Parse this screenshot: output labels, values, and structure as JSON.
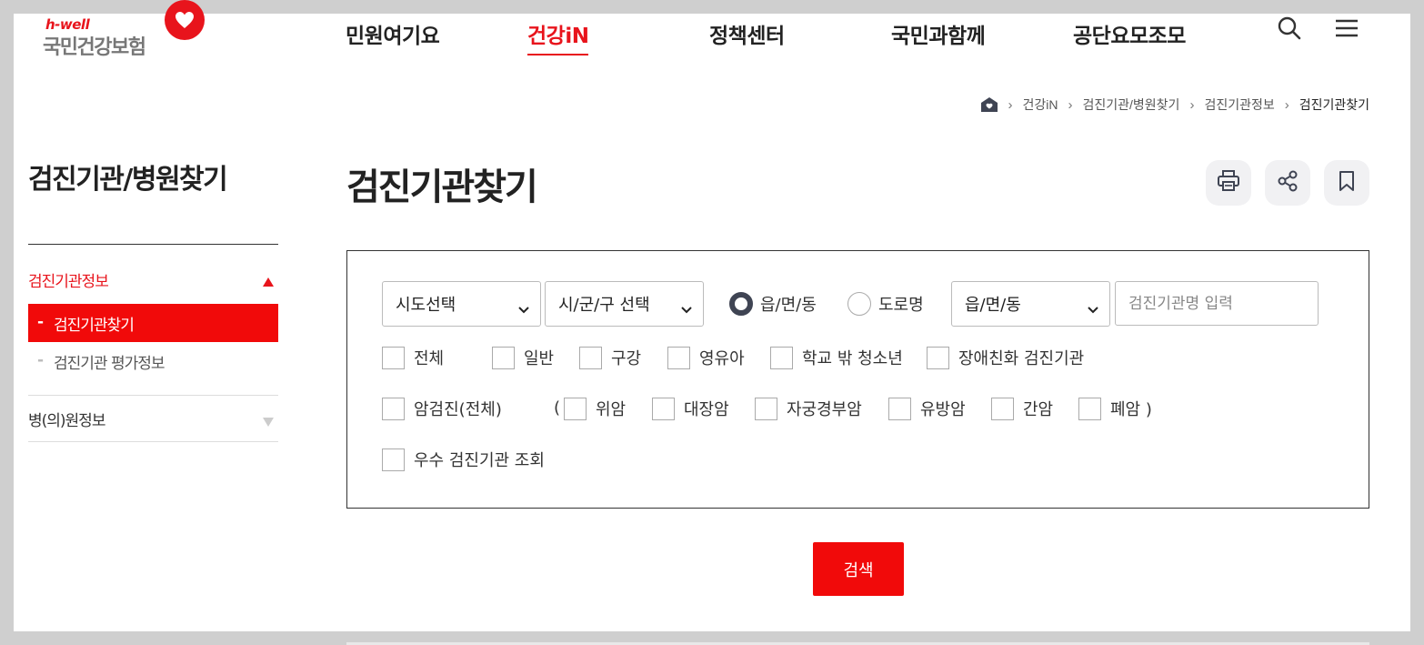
{
  "logo": {
    "tagline": "h-well",
    "name": "국민건강보험"
  },
  "gnb": {
    "items": [
      "민원여기요",
      "건강iN",
      "정책센터",
      "국민과함께",
      "공단요모조모"
    ],
    "active_index": 1
  },
  "header_icons": [
    "search-icon",
    "menu-icon"
  ],
  "breadcrumb": {
    "items": [
      "건강iN",
      "검진기관/병원찾기",
      "검진기관정보",
      "검진기관찾기"
    ],
    "separator": "›"
  },
  "lnb": {
    "title": "검진기관/병원찾기",
    "groups": [
      {
        "label": "검진기관정보",
        "expanded": true,
        "subs": [
          "검진기관찾기",
          "검진기관 평가정보"
        ],
        "active_sub": 0
      },
      {
        "label": "병(의)원정보",
        "expanded": false
      }
    ]
  },
  "content": {
    "title": "검진기관찾기",
    "utility_buttons": [
      "print-icon",
      "share-icon",
      "bookmark-icon"
    ]
  },
  "search": {
    "sido_select": "시도선택",
    "sigungu_select": "시/군/구 선택",
    "radios": [
      {
        "label": "읍/면/동",
        "checked": true
      },
      {
        "label": "도로명",
        "checked": false
      }
    ],
    "dong_select": "읍/면/동",
    "name_placeholder": "검진기관명 입력",
    "types_row1": [
      "전체",
      "일반",
      "구강",
      "영유아",
      "학교 밖 청소년",
      "장애친화 검진기관"
    ],
    "cancer_all": "암검진(전체)",
    "paren_open": "(",
    "cancer_types": [
      "위암",
      "대장암",
      "자궁경부암",
      "유방암",
      "간암",
      "폐암 )"
    ],
    "excellent": "우수 검진기관 조회",
    "button": "검색"
  },
  "colors": {
    "brand_red": "#e8141c",
    "button_red": "#f10a0a",
    "radio_dark": "#3f4453"
  }
}
